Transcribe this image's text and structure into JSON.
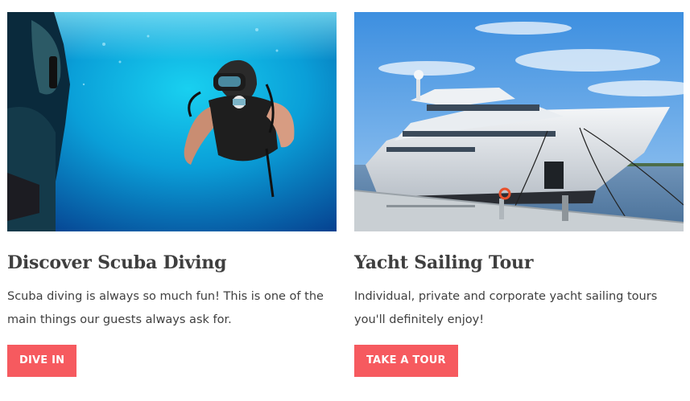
{
  "cards": [
    {
      "title": "Discover Scuba Diving",
      "description": "Scuba diving is always so much fun! This is one of the main things our guests always ask for.",
      "button_label": "DIVE IN",
      "image": "scuba-diver-underwater-photo"
    },
    {
      "title": "Yacht Sailing Tour",
      "description": "Individual, private and corporate yacht sailing tours you'll definitely enjoy!",
      "button_label": "TAKE A TOUR",
      "image": "yacht-at-dock-photo"
    }
  ],
  "colors": {
    "button": "#f65a5f",
    "heading": "#3f3f3f",
    "text": "#3f3f3f"
  }
}
